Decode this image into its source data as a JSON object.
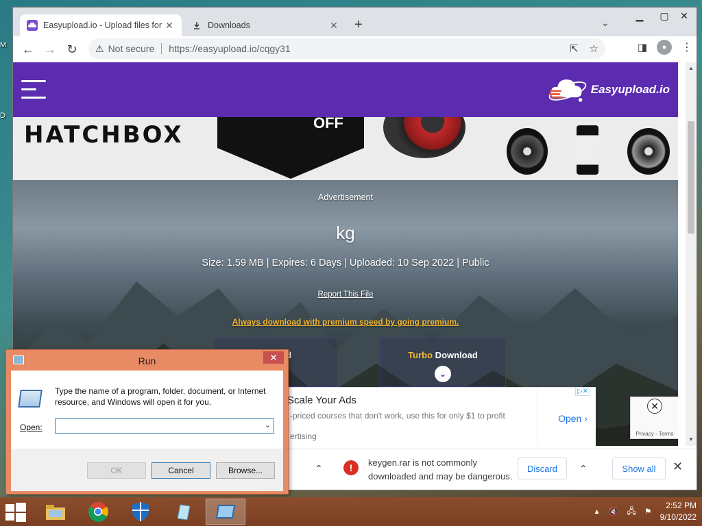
{
  "desktop": {
    "icon_label_1": "M",
    "icon_label_2": "D"
  },
  "browser": {
    "tabs": [
      {
        "title": "Easyupload.io - Upload files for f",
        "active": true,
        "favicon": "easyupload-icon"
      },
      {
        "title": "Downloads",
        "active": false,
        "favicon": "download-icon"
      }
    ],
    "new_tab": "+",
    "security_label": "Not secure",
    "url": "https://easyupload.io/cqgy31"
  },
  "site": {
    "logo_text": "Easyupload.io",
    "ad_brand": "HATCHBOX",
    "ad_off": "OFF",
    "advertisement_label": "Advertisement",
    "file_name": "kg",
    "meta": "Size: 1.59 MB | Expires: 6 Days | Uploaded: 10 Sep 2022 | Public",
    "report_link": "Report This File",
    "premium_link": "Always download with premium speed by going premium.",
    "download_partial": "ad",
    "turbo_word": "Turbo",
    "turbo_rest": " Download",
    "bottom_ad": {
      "headline": "Scale Your Ads",
      "line1": "-priced courses that don't work, use this for only $1 to profit",
      "line2": "ertising",
      "open": "Open"
    },
    "recaptcha_terms": "Privacy - Terms"
  },
  "download_bar": {
    "message_line1": "keygen.rar is not commonly",
    "message_line2": "downloaded and may be dangerous.",
    "discard": "Discard",
    "show_all": "Show all"
  },
  "run_dialog": {
    "title": "Run",
    "description": "Type the name of a program, folder, document, or Internet resource, and Windows will open it for you.",
    "open_label": "Open:",
    "open_value": "",
    "ok": "OK",
    "cancel": "Cancel",
    "browse": "Browse..."
  },
  "taskbar": {
    "time": "2:52 PM",
    "date": "9/10/2022"
  },
  "colors": {
    "site_purple": "#5b2bb0",
    "premium_yellow": "#f5b731",
    "run_frame": "#e88a63",
    "taskbar": "#7a3f22"
  }
}
